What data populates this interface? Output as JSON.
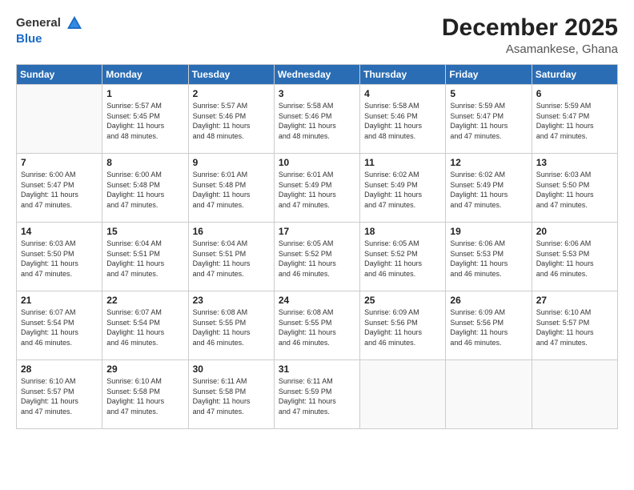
{
  "header": {
    "logo_general": "General",
    "logo_blue": "Blue",
    "title": "December 2025",
    "location": "Asamankese, Ghana"
  },
  "weekdays": [
    "Sunday",
    "Monday",
    "Tuesday",
    "Wednesday",
    "Thursday",
    "Friday",
    "Saturday"
  ],
  "weeks": [
    [
      {
        "day": "",
        "empty": true
      },
      {
        "day": "1",
        "sunrise": "5:57 AM",
        "sunset": "5:45 PM",
        "daylight": "11 hours and 48 minutes."
      },
      {
        "day": "2",
        "sunrise": "5:57 AM",
        "sunset": "5:46 PM",
        "daylight": "11 hours and 48 minutes."
      },
      {
        "day": "3",
        "sunrise": "5:58 AM",
        "sunset": "5:46 PM",
        "daylight": "11 hours and 48 minutes."
      },
      {
        "day": "4",
        "sunrise": "5:58 AM",
        "sunset": "5:46 PM",
        "daylight": "11 hours and 48 minutes."
      },
      {
        "day": "5",
        "sunrise": "5:59 AM",
        "sunset": "5:47 PM",
        "daylight": "11 hours and 47 minutes."
      },
      {
        "day": "6",
        "sunrise": "5:59 AM",
        "sunset": "5:47 PM",
        "daylight": "11 hours and 47 minutes."
      }
    ],
    [
      {
        "day": "7",
        "sunrise": "6:00 AM",
        "sunset": "5:47 PM",
        "daylight": "11 hours and 47 minutes."
      },
      {
        "day": "8",
        "sunrise": "6:00 AM",
        "sunset": "5:48 PM",
        "daylight": "11 hours and 47 minutes."
      },
      {
        "day": "9",
        "sunrise": "6:01 AM",
        "sunset": "5:48 PM",
        "daylight": "11 hours and 47 minutes."
      },
      {
        "day": "10",
        "sunrise": "6:01 AM",
        "sunset": "5:49 PM",
        "daylight": "11 hours and 47 minutes."
      },
      {
        "day": "11",
        "sunrise": "6:02 AM",
        "sunset": "5:49 PM",
        "daylight": "11 hours and 47 minutes."
      },
      {
        "day": "12",
        "sunrise": "6:02 AM",
        "sunset": "5:49 PM",
        "daylight": "11 hours and 47 minutes."
      },
      {
        "day": "13",
        "sunrise": "6:03 AM",
        "sunset": "5:50 PM",
        "daylight": "11 hours and 47 minutes."
      }
    ],
    [
      {
        "day": "14",
        "sunrise": "6:03 AM",
        "sunset": "5:50 PM",
        "daylight": "11 hours and 47 minutes."
      },
      {
        "day": "15",
        "sunrise": "6:04 AM",
        "sunset": "5:51 PM",
        "daylight": "11 hours and 47 minutes."
      },
      {
        "day": "16",
        "sunrise": "6:04 AM",
        "sunset": "5:51 PM",
        "daylight": "11 hours and 47 minutes."
      },
      {
        "day": "17",
        "sunrise": "6:05 AM",
        "sunset": "5:52 PM",
        "daylight": "11 hours and 46 minutes."
      },
      {
        "day": "18",
        "sunrise": "6:05 AM",
        "sunset": "5:52 PM",
        "daylight": "11 hours and 46 minutes."
      },
      {
        "day": "19",
        "sunrise": "6:06 AM",
        "sunset": "5:53 PM",
        "daylight": "11 hours and 46 minutes."
      },
      {
        "day": "20",
        "sunrise": "6:06 AM",
        "sunset": "5:53 PM",
        "daylight": "11 hours and 46 minutes."
      }
    ],
    [
      {
        "day": "21",
        "sunrise": "6:07 AM",
        "sunset": "5:54 PM",
        "daylight": "11 hours and 46 minutes."
      },
      {
        "day": "22",
        "sunrise": "6:07 AM",
        "sunset": "5:54 PM",
        "daylight": "11 hours and 46 minutes."
      },
      {
        "day": "23",
        "sunrise": "6:08 AM",
        "sunset": "5:55 PM",
        "daylight": "11 hours and 46 minutes."
      },
      {
        "day": "24",
        "sunrise": "6:08 AM",
        "sunset": "5:55 PM",
        "daylight": "11 hours and 46 minutes."
      },
      {
        "day": "25",
        "sunrise": "6:09 AM",
        "sunset": "5:56 PM",
        "daylight": "11 hours and 46 minutes."
      },
      {
        "day": "26",
        "sunrise": "6:09 AM",
        "sunset": "5:56 PM",
        "daylight": "11 hours and 46 minutes."
      },
      {
        "day": "27",
        "sunrise": "6:10 AM",
        "sunset": "5:57 PM",
        "daylight": "11 hours and 47 minutes."
      }
    ],
    [
      {
        "day": "28",
        "sunrise": "6:10 AM",
        "sunset": "5:57 PM",
        "daylight": "11 hours and 47 minutes."
      },
      {
        "day": "29",
        "sunrise": "6:10 AM",
        "sunset": "5:58 PM",
        "daylight": "11 hours and 47 minutes."
      },
      {
        "day": "30",
        "sunrise": "6:11 AM",
        "sunset": "5:58 PM",
        "daylight": "11 hours and 47 minutes."
      },
      {
        "day": "31",
        "sunrise": "6:11 AM",
        "sunset": "5:59 PM",
        "daylight": "11 hours and 47 minutes."
      },
      {
        "day": "",
        "empty": true
      },
      {
        "day": "",
        "empty": true
      },
      {
        "day": "",
        "empty": true
      }
    ]
  ]
}
